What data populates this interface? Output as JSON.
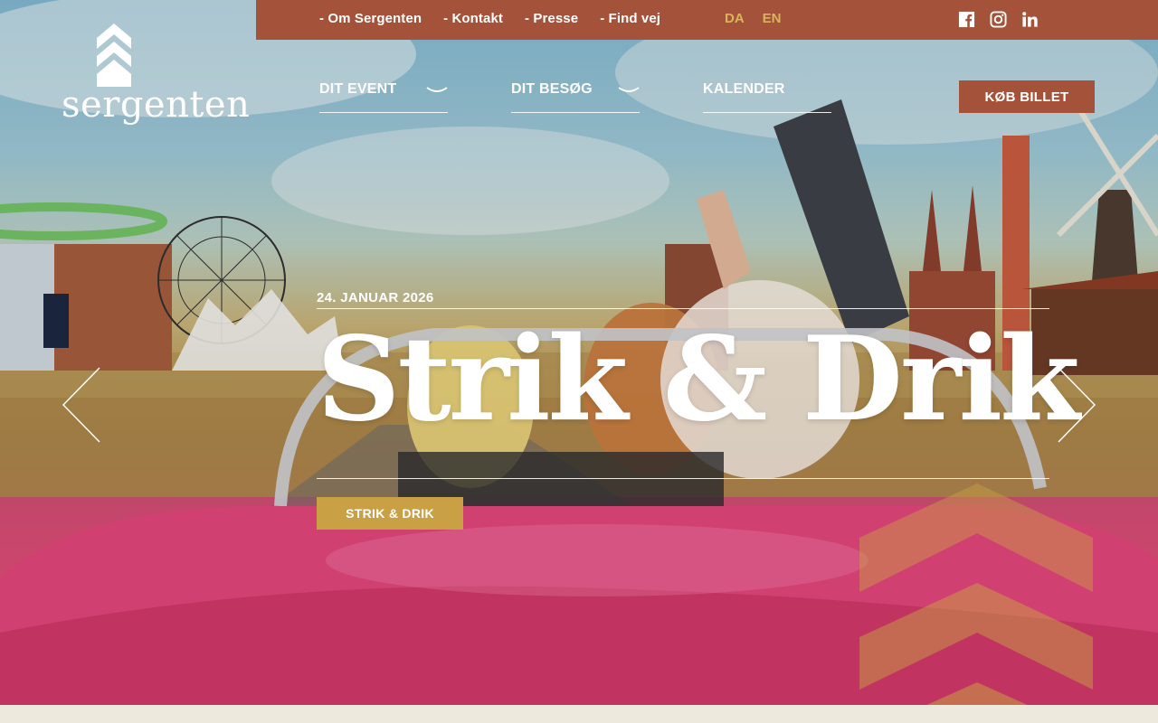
{
  "topbar": {
    "links": [
      "- Om Sergenten",
      "- Kontakt",
      "- Presse",
      "- Find vej"
    ],
    "languages": [
      "DA",
      "EN"
    ],
    "social": [
      "facebook-icon",
      "instagram-icon",
      "linkedin-icon"
    ],
    "background_color": "#a5523a"
  },
  "logo": {
    "text": "sergenten"
  },
  "nav": {
    "items": [
      {
        "label": "DIT EVENT",
        "has_dropdown": true
      },
      {
        "label": "DIT BESØG",
        "has_dropdown": true
      },
      {
        "label": "KALENDER",
        "has_dropdown": false
      }
    ],
    "buy_label": "KØB BILLET"
  },
  "slide": {
    "date": "24. JANUAR 2026",
    "headline": "Strik & Drik",
    "cta_label": "STRIK & DRIK",
    "cta_color": "#c9a144",
    "prev_icon": "chevron-left-icon",
    "next_icon": "chevron-right-icon"
  },
  "colors": {
    "accent": "#a5523a",
    "gold": "#c9a144",
    "footer_band": "#ede9dc"
  }
}
